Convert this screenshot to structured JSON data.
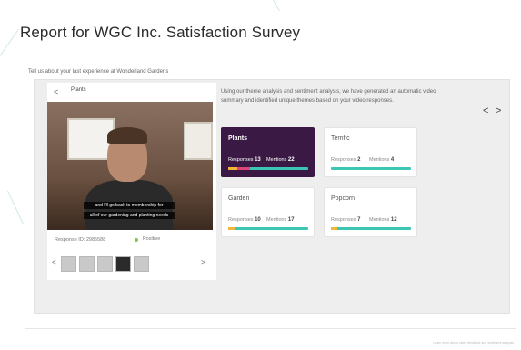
{
  "page": {
    "title": "Report for WGC Inc. Satisfaction Survey"
  },
  "question": {
    "text": "Tell us about your last experience at Wonderland Gardens"
  },
  "response_panel": {
    "back_label": "<",
    "topic_label": "Plants",
    "caption_lines": [
      "and I'll go back to membership for",
      "all of our gardening and planting needs"
    ],
    "response_id": "Response ID: 2985588",
    "status": "Positive",
    "thumbs_prev": "<",
    "thumbs_next": ">"
  },
  "summary": {
    "text": "Using our theme analysis and sentiment analysis, we have generated an automatic video summary and identified unique themes based on your video responses."
  },
  "nav": {
    "prev": "<",
    "next": ">"
  },
  "themes": [
    {
      "name": "Plants",
      "responses_label": "Responses",
      "responses": "13",
      "mentions_label": "Mentions",
      "mentions": "22",
      "active": true
    },
    {
      "name": "Terrific",
      "responses_label": "Responses",
      "responses": "2",
      "mentions_label": "Mentions",
      "mentions": "4",
      "active": false
    },
    {
      "name": "Garden",
      "responses_label": "Responses",
      "responses": "10",
      "mentions_label": "Mentions",
      "mentions": "17",
      "active": false
    },
    {
      "name": "Popcorn",
      "responses_label": "Responses",
      "responses": "7",
      "mentions_label": "Mentions",
      "mentions": "12",
      "active": false
    }
  ],
  "footer": {
    "text": "Learn more about video feedback and sentiment analysis"
  },
  "colors": {
    "accent": "#3a1a44",
    "positive": "#3cc7b4",
    "neutral": "#f4b63a",
    "negative": "#e0457a"
  }
}
